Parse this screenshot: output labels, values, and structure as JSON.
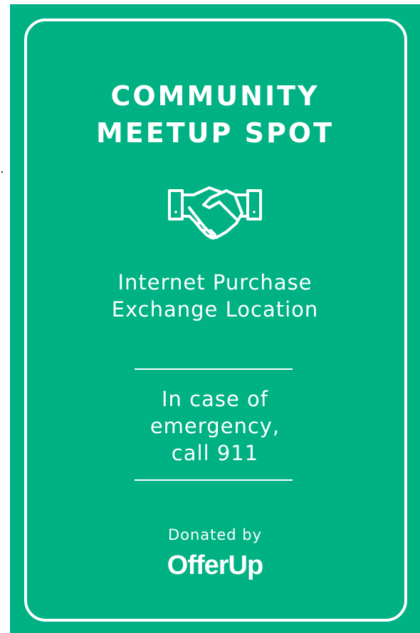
{
  "colors": {
    "sign_background": "#00b184",
    "foreground": "#ffffff"
  },
  "title_lines": [
    "COMMUNITY",
    "MEETUP SPOT"
  ],
  "icon": "handshake-icon",
  "location_lines": [
    "Internet Purchase",
    "Exchange Location"
  ],
  "emergency_lines": [
    "In case of",
    "emergency,",
    "call 911"
  ],
  "donated_by": "Donated by",
  "logo_text": "OfferUp"
}
